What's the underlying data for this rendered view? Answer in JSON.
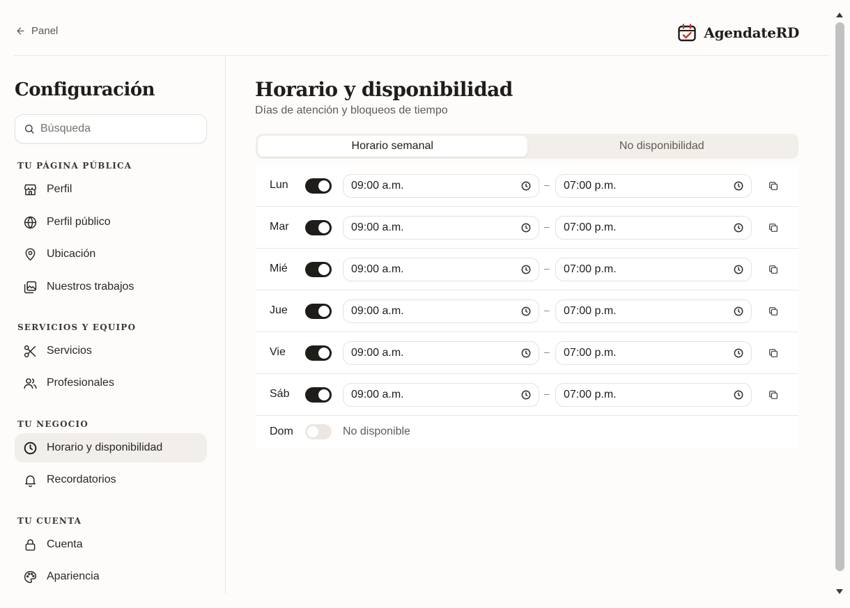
{
  "topbar": {
    "back_label": "Panel",
    "brand_name": "AgendateRD"
  },
  "sidebar": {
    "title": "Configuración",
    "search_placeholder": "Búsqueda",
    "sections": [
      {
        "label": "Tu página pública",
        "items": [
          {
            "label": "Perfil",
            "icon": "store-icon"
          },
          {
            "label": "Perfil público",
            "icon": "globe-icon"
          },
          {
            "label": "Ubicación",
            "icon": "map-pin-icon"
          },
          {
            "label": "Nuestros trabajos",
            "icon": "gallery-icon"
          }
        ]
      },
      {
        "label": "Servicios y equipo",
        "items": [
          {
            "label": "Servicios",
            "icon": "scissors-icon"
          },
          {
            "label": "Profesionales",
            "icon": "users-icon"
          }
        ]
      },
      {
        "label": "Tu negocio",
        "items": [
          {
            "label": "Horario y disponibilidad",
            "icon": "clock-icon",
            "active": true
          },
          {
            "label": "Recordatorios",
            "icon": "bell-icon"
          }
        ]
      },
      {
        "label": "Tu cuenta",
        "items": [
          {
            "label": "Cuenta",
            "icon": "lock-icon"
          },
          {
            "label": "Apariencia",
            "icon": "palette-icon"
          }
        ]
      }
    ]
  },
  "main": {
    "title": "Horario y disponibilidad",
    "subtitle": "Días de atención y bloqueos de tiempo",
    "tabs": [
      {
        "label": "Horario semanal",
        "active": true
      },
      {
        "label": "No disponibilidad",
        "active": false
      }
    ],
    "separator": "–",
    "days": [
      {
        "day": "Lun",
        "enabled": true,
        "start": "09:00 a.m.",
        "end": "07:00 p.m."
      },
      {
        "day": "Mar",
        "enabled": true,
        "start": "09:00 a.m.",
        "end": "07:00 p.m."
      },
      {
        "day": "Mié",
        "enabled": true,
        "start": "09:00 a.m.",
        "end": "07:00 p.m."
      },
      {
        "day": "Jue",
        "enabled": true,
        "start": "09:00 a.m.",
        "end": "07:00 p.m."
      },
      {
        "day": "Vie",
        "enabled": true,
        "start": "09:00 a.m.",
        "end": "07:00 p.m."
      },
      {
        "day": "Sáb",
        "enabled": true,
        "start": "09:00 a.m.",
        "end": "07:00 p.m."
      },
      {
        "day": "Dom",
        "enabled": false,
        "unavailable_label": "No disponible"
      }
    ]
  },
  "colors": {
    "background": "#fdfcfa",
    "text": "#1f1d1a",
    "muted": "#5f5a54",
    "border": "#ebe7e1",
    "toggle_on": "#1f1d1a",
    "toggle_off": "#ebe8e3",
    "brand_accent": "#c0392b"
  }
}
